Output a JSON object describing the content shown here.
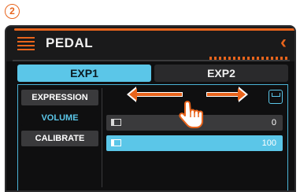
{
  "step_marker": "2",
  "header": {
    "title": "PEDAL",
    "back_icon": "chevron-left-icon"
  },
  "tabs": [
    {
      "label": "EXP1",
      "selected": true
    },
    {
      "label": "EXP2",
      "selected": false
    }
  ],
  "menu": [
    {
      "label": "EXPRESSION",
      "selected": false
    },
    {
      "label": "VOLUME",
      "selected": true
    },
    {
      "label": "CALIBRATE",
      "selected": false
    }
  ],
  "sliders": [
    {
      "icon": "pedal-up-icon",
      "value": "0",
      "highlighted": false
    },
    {
      "icon": "pedal-down-icon",
      "value": "100",
      "highlighted": true
    }
  ],
  "colors": {
    "accent": "#e8641c",
    "highlight": "#5bc6e8",
    "background": "#0f0f10"
  }
}
